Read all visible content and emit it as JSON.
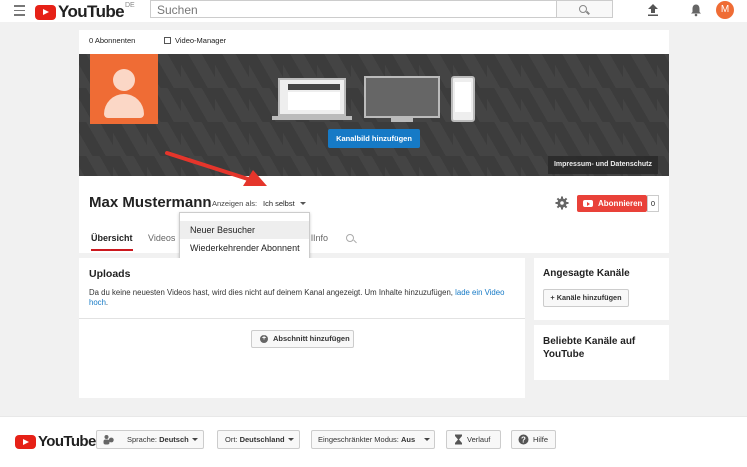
{
  "masthead": {
    "logo_word": "YouTube",
    "logo_country": "DE",
    "search_placeholder": "Suchen",
    "avatar_letter": "M"
  },
  "channel": {
    "subscribers_label": "0 Abonnenten",
    "video_manager_label": "Video-Manager",
    "add_art_label": "Kanalbild hinzufügen",
    "impressum_label": "Impressum- und Datenschutz",
    "name": "Max Mustermann",
    "view_as_label": "Anzeigen als:",
    "view_as_value": "Ich selbst",
    "subscribe_label": "Abonnieren",
    "subscribe_count": "0",
    "tabs": [
      {
        "label": "Übersicht"
      },
      {
        "label": "Videos"
      },
      {
        "label": "lInfo"
      }
    ]
  },
  "dropdown": {
    "items": [
      {
        "label": "Neuer Besucher"
      },
      {
        "label": "Wiederkehrender Abonnent"
      }
    ]
  },
  "uploads": {
    "title": "Uploads",
    "message": "Da du keine neuesten Videos hast, wird dies nicht auf deinem Kanal angezeigt. Um Inhalte hinzuzufügen,",
    "message_link": "lade ein Video hoch",
    "message_end": ".",
    "add_section_label": "Abschnitt hinzufügen"
  },
  "featured": {
    "title": "Angesagte Kanäle",
    "add_label": "+ Kanäle hinzufügen"
  },
  "popular": {
    "title": "Beliebte Kanäle auf YouTube"
  },
  "footer": {
    "logo_word": "YouTube",
    "language_label": "Sprache:",
    "language_value": "Deutsch",
    "location_label": "Ort:",
    "location_value": "Deutschland",
    "restricted_label": "Eingeschränkter Modus:",
    "restricted_value": "Aus",
    "history_label": "Verlauf",
    "help_label": "Hilfe"
  },
  "colors": {
    "brand_red": "#e62117",
    "link_blue": "#167ac6",
    "avatar_orange": "#ef6c35"
  }
}
